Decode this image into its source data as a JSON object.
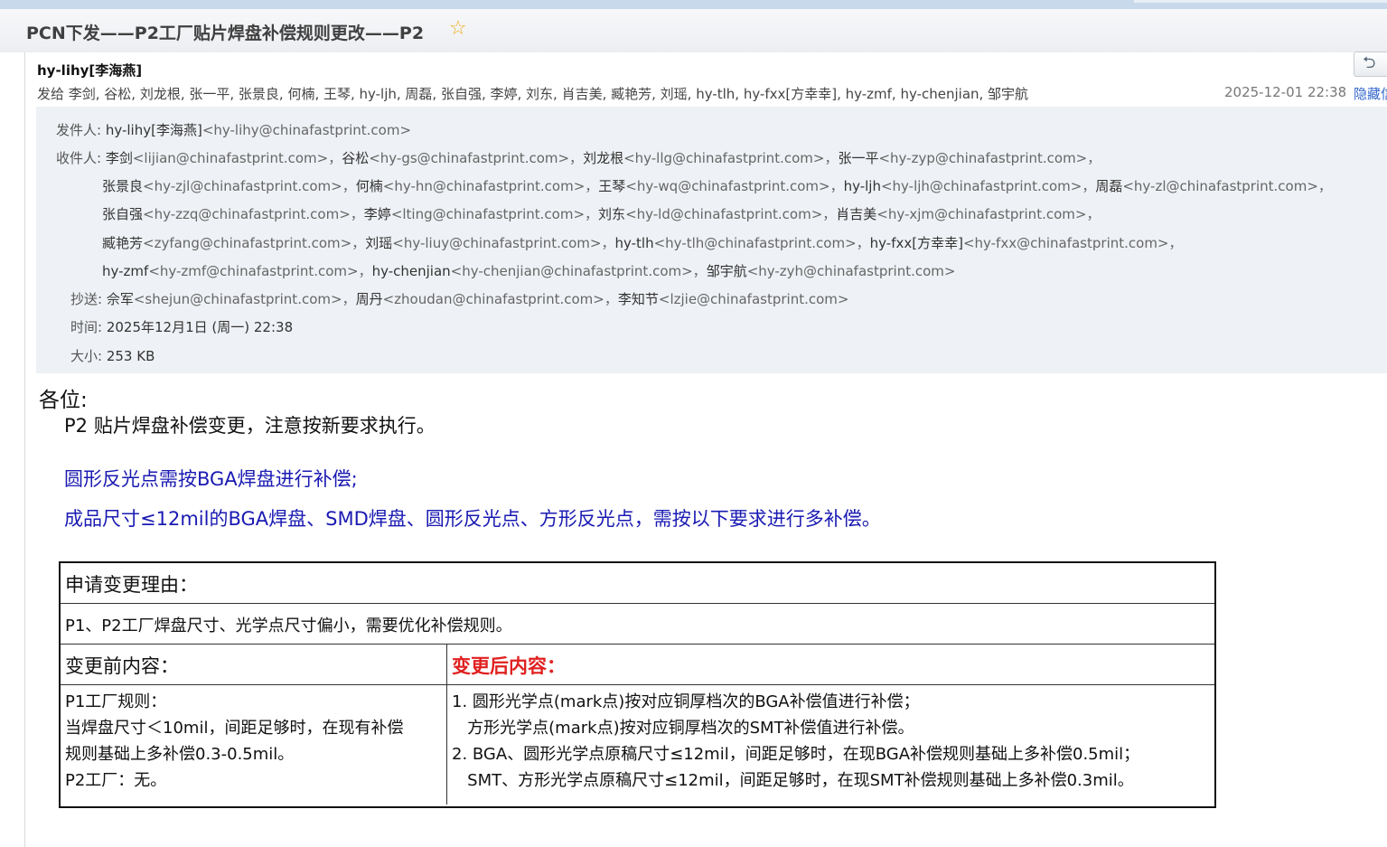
{
  "email": {
    "subject": "PCN下发——P2工厂贴片焊盘补偿规则更改——P2",
    "sender": "hy-lihy[李海燕]",
    "recipients_summary": "发给 李剑, 谷松, 刘龙根, 张一平, 张景良, 何楠, 王琴, hy-ljh, 周磊, 张自强, 李婷, 刘东, 肖吉美, 臧艳芳, 刘瑶, hy-tlh, hy-fxx[方幸幸], hy-zmf, hy-chenjian, 邹宇航",
    "sent_time": "2025-12-01 22:38",
    "hide_link": "隐藏信"
  },
  "details": {
    "from_label": "发件人:",
    "from_name": "hy-lihy[李海燕]",
    "from_email": "<hy-lihy@chinafastprint.com>",
    "to_label": "收件人:",
    "to_lines": [
      [
        {
          "name": "李剑",
          "email": "<lijian@chinafastprint.com>，"
        },
        {
          "name": "谷松",
          "email": "<hy-gs@chinafastprint.com>，"
        },
        {
          "name": "刘龙根",
          "email": "<hy-llg@chinafastprint.com>，"
        },
        {
          "name": "张一平",
          "email": "<hy-zyp@chinafastprint.com>，"
        }
      ],
      [
        {
          "name": "张景良",
          "email": "<hy-zjl@chinafastprint.com>，"
        },
        {
          "name": "何楠",
          "email": "<hy-hn@chinafastprint.com>，"
        },
        {
          "name": "王琴",
          "email": "<hy-wq@chinafastprint.com>，"
        },
        {
          "name": "hy-ljh",
          "email": "<hy-ljh@chinafastprint.com>，"
        },
        {
          "name": "周磊",
          "email": "<hy-zl@chinafastprint.com>，"
        }
      ],
      [
        {
          "name": "张自强",
          "email": "<hy-zzq@chinafastprint.com>，"
        },
        {
          "name": "李婷",
          "email": "<lting@chinafastprint.com>，"
        },
        {
          "name": "刘东",
          "email": "<hy-ld@chinafastprint.com>，"
        },
        {
          "name": "肖吉美",
          "email": "<hy-xjm@chinafastprint.com>，"
        }
      ],
      [
        {
          "name": "臧艳芳",
          "email": "<zyfang@chinafastprint.com>，"
        },
        {
          "name": "刘瑶",
          "email": "<hy-liuy@chinafastprint.com>，"
        },
        {
          "name": "hy-tlh",
          "email": "<hy-tlh@chinafastprint.com>，"
        },
        {
          "name": "hy-fxx[方幸幸]",
          "email": "<hy-fxx@chinafastprint.com>，"
        }
      ],
      [
        {
          "name": "hy-zmf",
          "email": "<hy-zmf@chinafastprint.com>，"
        },
        {
          "name": "hy-chenjian",
          "email": "<hy-chenjian@chinafastprint.com>，"
        },
        {
          "name": "邹宇航",
          "email": "<hy-zyh@chinafastprint.com>"
        }
      ]
    ],
    "cc_label": "抄送:",
    "cc": [
      {
        "name": "佘军",
        "email": "<shejun@chinafastprint.com>，"
      },
      {
        "name": "周丹",
        "email": "<zhoudan@chinafastprint.com>，"
      },
      {
        "name": "李知节",
        "email": "<lzjie@chinafastprint.com>"
      }
    ],
    "time_label": "时间:",
    "time_value": "2025年12月1日 (周一) 22:38",
    "size_label": "大小:",
    "size_value": "253 KB"
  },
  "body": {
    "greeting": "各位:",
    "intro": "P2  贴片焊盘补偿变更，注意按新要求执行。",
    "blue_line_1": "圆形反光点需按BGA焊盘进行补偿;",
    "blue_line_2": "成品尺寸≤12mil的BGA焊盘、SMD焊盘、圆形反光点、方形反光点，需按以下要求进行多补偿。"
  },
  "table": {
    "reason_title": "申请变更理由：",
    "reason_text": "P1、P2工厂焊盘尺寸、光学点尺寸偏小，需要优化补偿规则。",
    "before_title": "变更前内容：",
    "after_title": "变更后内容：",
    "before_lines": [
      "P1工厂规则：",
      "当焊盘尺寸＜10mil，间距足够时，在现有补偿",
      "规则基础上多补偿0.3-0.5mil。",
      "P2工厂：无。"
    ],
    "after_lines": [
      "1. 圆形光学点(mark点)按对应铜厚档次的BGA补偿值进行补偿；",
      "   方形光学点(mark点)按对应铜厚档次的SMT补偿值进行补偿。",
      "2. BGA、圆形光学点原稿尺寸≤12mil，间距足够时，在现BGA补偿规则基础上多补偿0.5mil；",
      "   SMT、方形光学点原稿尺寸≤12mil，间距足够时，在现SMT补偿规则基础上多补偿0.3mil。"
    ]
  },
  "colors": {
    "blue_text": "#1a1ab3",
    "red_title": "#e02020",
    "star": "#f2b01e",
    "detail_bg": "#eef1f5"
  }
}
